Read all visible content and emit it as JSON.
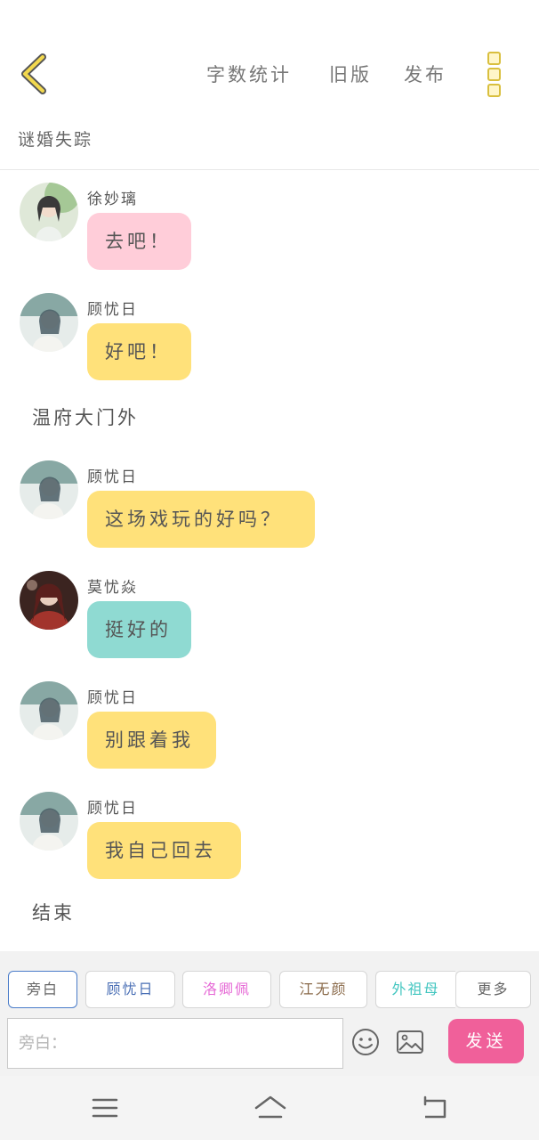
{
  "header": {
    "back_icon": "chevron-left-icon",
    "actions": [
      "字数统计",
      "旧版",
      "发布"
    ],
    "more_icon": "vertical-dots-icon",
    "accent": "#d9bf3e"
  },
  "story": {
    "title": "谜婚失踪"
  },
  "messages": [
    {
      "sender": "徐妙璃",
      "text": "去吧！",
      "bubble_color": "#ffcdd9",
      "avatar_palette": [
        "#7fb26a",
        "#dfe8d8",
        "#3a3a3a"
      ]
    },
    {
      "sender": "顾忧日",
      "text": "好吧！",
      "bubble_color": "#ffe17a",
      "avatar_palette": [
        "#88a8a4",
        "#e6ecea",
        "#4a5e66"
      ]
    },
    {
      "narration": "温府大门外"
    },
    {
      "sender": "顾忧日",
      "text": "这场戏玩的好吗？",
      "bubble_color": "#ffe17a",
      "avatar_palette": [
        "#88a8a4",
        "#e6ecea",
        "#4a5e66"
      ]
    },
    {
      "sender": "莫忧焱",
      "text": "挺好的",
      "bubble_color": "#8fdad2",
      "avatar_palette": [
        "#a2342c",
        "#d8b8a6",
        "#3b2420"
      ]
    },
    {
      "sender": "顾忧日",
      "text": "别跟着我",
      "bubble_color": "#ffe17a",
      "avatar_palette": [
        "#88a8a4",
        "#e6ecea",
        "#4a5e66"
      ]
    },
    {
      "sender": "顾忧日",
      "text": "我自己回去",
      "bubble_color": "#ffe17a",
      "avatar_palette": [
        "#88a8a4",
        "#e6ecea",
        "#4a5e66"
      ]
    },
    {
      "narration": "结束"
    }
  ],
  "roles": [
    {
      "label": "旁白",
      "color": "#666666",
      "active": true
    },
    {
      "label": "顾忧日",
      "color": "#4a6fb5",
      "active": false
    },
    {
      "label": "洛卿佩",
      "color": "#e66ad6",
      "active": false
    },
    {
      "label": "江无颜",
      "color": "#8a6a4a",
      "active": false
    },
    {
      "label": "外祖母",
      "color": "#43c6c0",
      "active": false
    }
  ],
  "roles_more": "更多",
  "input": {
    "placeholder": "旁白：",
    "value": ""
  },
  "tools": {
    "emoji_icon": "smiley-face-icon",
    "image_icon": "image-icon"
  },
  "send": {
    "label": "发送",
    "color": "#f0609a"
  },
  "system_nav": [
    "menu-icon",
    "home-icon",
    "back-icon"
  ]
}
